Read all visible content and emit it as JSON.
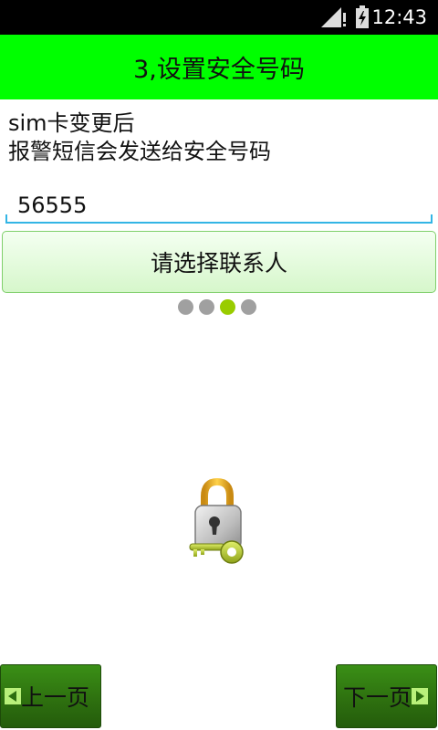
{
  "status_bar": {
    "time": "12:43",
    "icons": [
      "signal-icon",
      "battery-charging-icon"
    ]
  },
  "header": {
    "title": "3,设置安全号码",
    "background_color": "#00ff00"
  },
  "description": {
    "line1": "sim卡变更后",
    "line2": "报警短信会发送给安全号码"
  },
  "safe_number_input": {
    "value": "56555",
    "accent_color": "#33b5e5"
  },
  "select_contact_button": {
    "label": "请选择联系人"
  },
  "page_indicator": {
    "total": 4,
    "current": 3,
    "active_color": "#99cc00"
  },
  "illustration": {
    "icon": "lock-and-key-icon"
  },
  "navigation": {
    "prev_label": "上一页",
    "next_label": "下一页",
    "button_color": "#2d6e0f"
  }
}
